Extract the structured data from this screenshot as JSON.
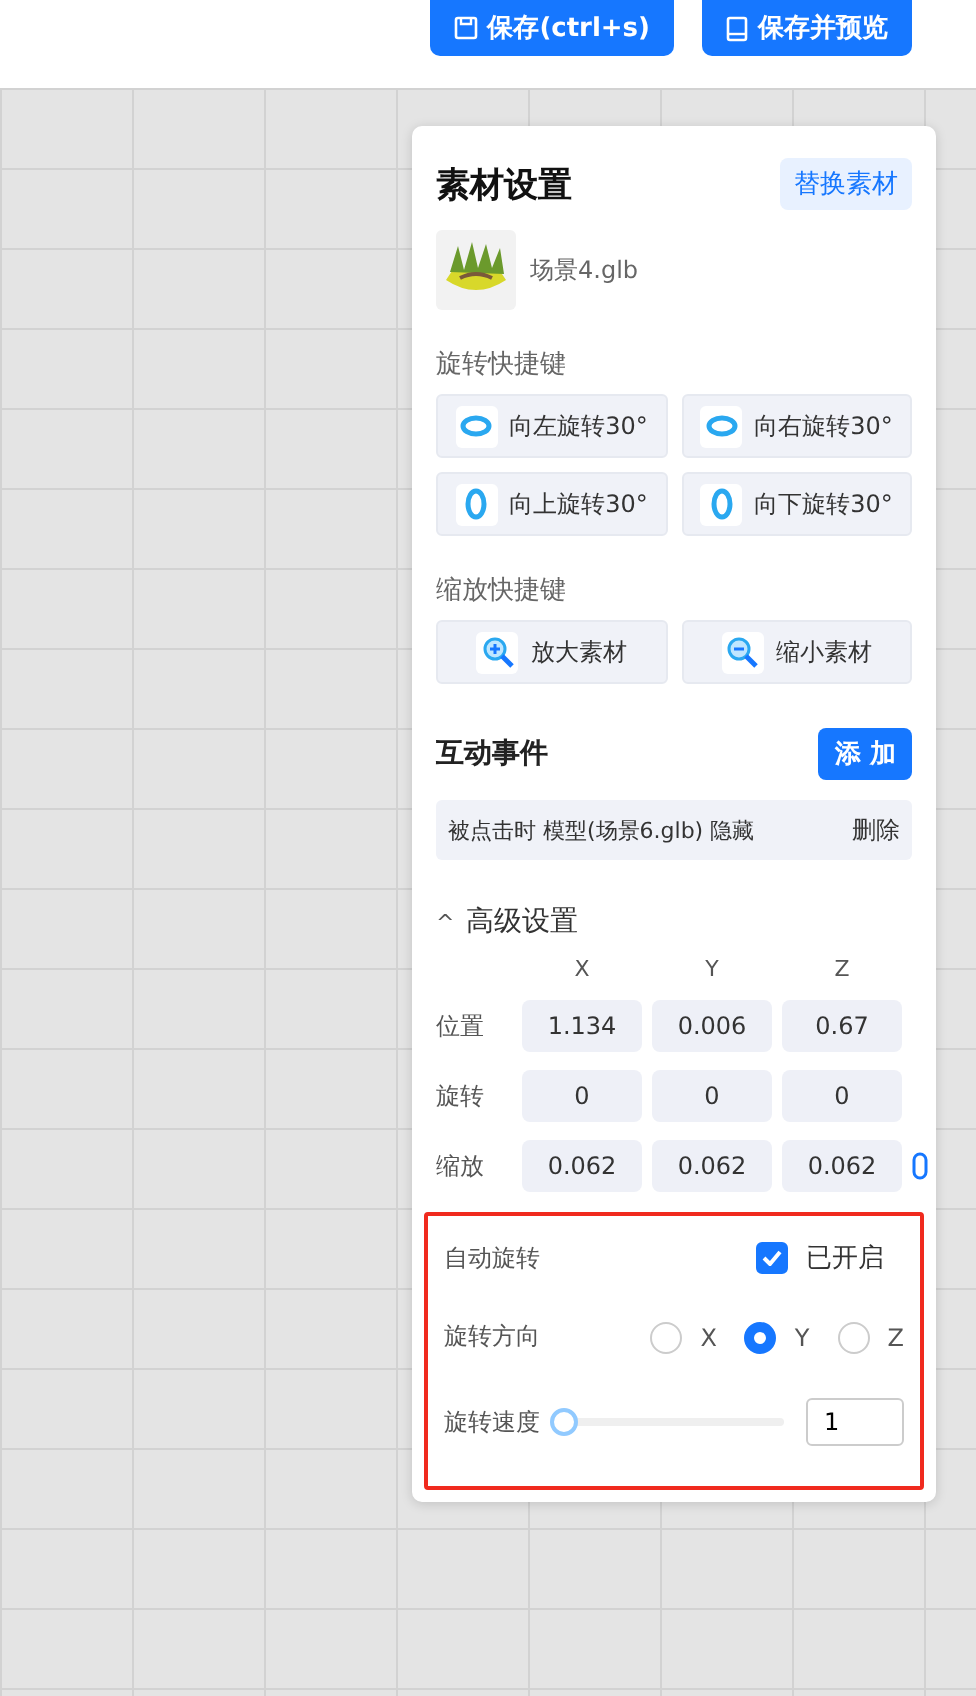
{
  "toolbar": {
    "buttons": [
      {
        "label": "保存(ctrl+s)",
        "kind": "save"
      },
      {
        "label": "保存并预览",
        "kind": "preview"
      }
    ]
  },
  "panel": {
    "title": "素材设置",
    "replace_button": "替换素材",
    "asset": {
      "name": "场景4.glb"
    },
    "rotate_shortcuts": {
      "title": "旋转快捷键",
      "buttons": [
        {
          "label": "向左旋转30°",
          "kind": "horizontal"
        },
        {
          "label": "向右旋转30°",
          "kind": "horizontal"
        },
        {
          "label": "向上旋转30°",
          "kind": "vertical"
        },
        {
          "label": "向下旋转30°",
          "kind": "vertical"
        }
      ]
    },
    "zoom_shortcuts": {
      "title": "缩放快捷键",
      "buttons": [
        {
          "label": "放大素材",
          "kind": "zoom-in"
        },
        {
          "label": "缩小素材",
          "kind": "zoom-out"
        }
      ]
    },
    "events": {
      "title": "互动事件",
      "add_button": "添 加",
      "items": [
        {
          "text": "被点击时 模型(场景6.glb) 隐藏",
          "delete": "删除"
        }
      ]
    },
    "advanced": {
      "title": "高级设置",
      "expanded": true,
      "toggle": "^",
      "columns": [
        "X",
        "Y",
        "Z"
      ],
      "rows": [
        {
          "label": "位置",
          "values": [
            "1.134",
            "0.006",
            "0.67"
          ],
          "linked": false
        },
        {
          "label": "旋转",
          "values": [
            "0",
            "0",
            "0"
          ],
          "linked": false
        },
        {
          "label": "缩放",
          "values": [
            "0.062",
            "0.062",
            "0.062"
          ],
          "linked": true
        }
      ]
    },
    "auto_rotate": {
      "highlighted": true,
      "label": "自动旋转",
      "checked": true,
      "status": "已开启",
      "direction": {
        "label": "旋转方向",
        "options": [
          {
            "label": "X",
            "selected": false
          },
          {
            "label": "Y",
            "selected": true
          },
          {
            "label": "Z",
            "selected": false
          }
        ]
      },
      "speed": {
        "label": "旋转速度",
        "level": 0,
        "value": "1"
      }
    }
  }
}
